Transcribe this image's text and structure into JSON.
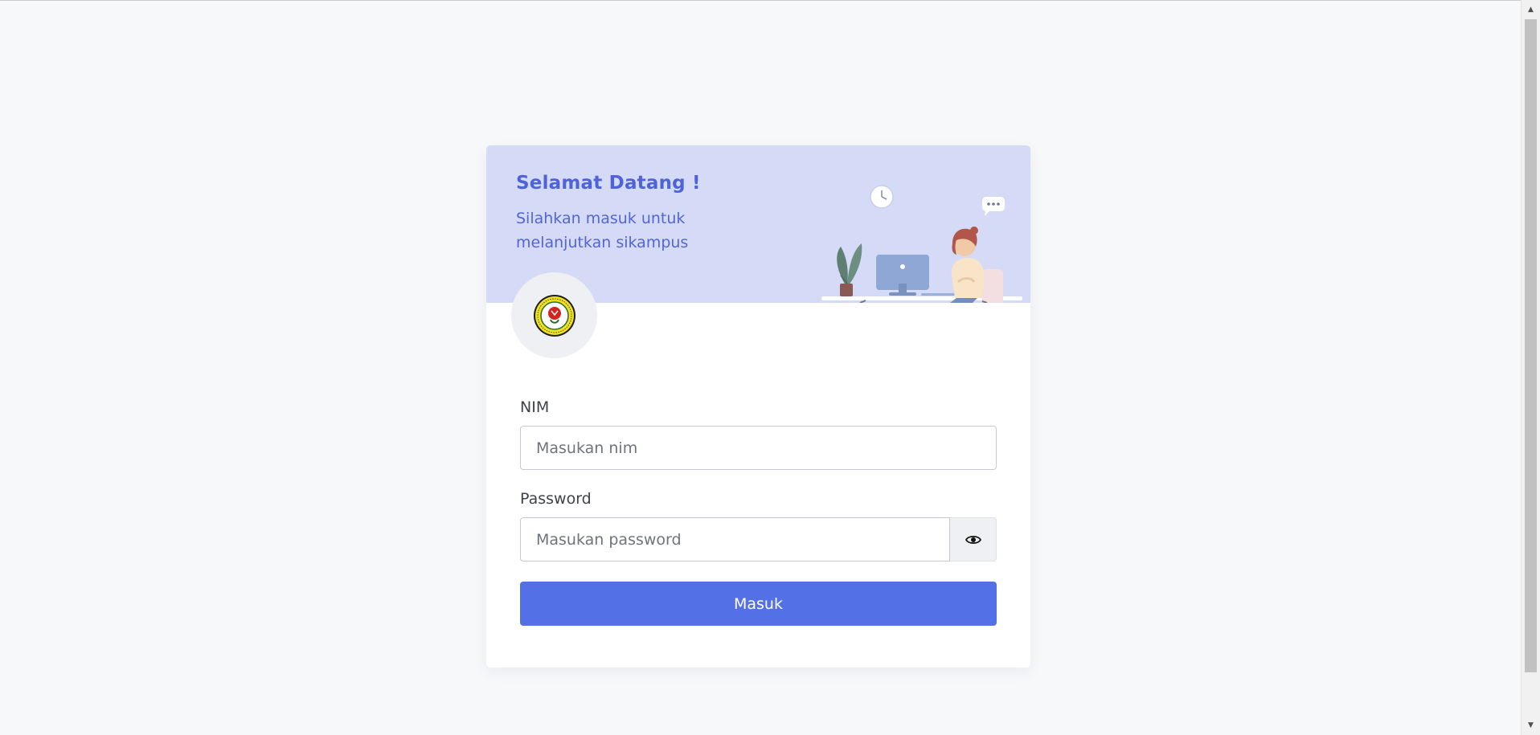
{
  "banner": {
    "title": "Selamat Datang !",
    "subtitle": "Silahkan masuk untuk melanjutkan sikampus",
    "illustration": "woman-at-desk-illustration",
    "logo": "university-seal-logo"
  },
  "form": {
    "nim_label": "NIM",
    "nim_placeholder": "Masukan nim",
    "password_label": "Password",
    "password_placeholder": "Masukan password",
    "toggle_icon": "eye-icon",
    "submit_label": "Masuk"
  },
  "colors": {
    "background": "#f7f8fa",
    "banner": "#d5daf7",
    "accent": "#5470e6",
    "title": "#4e63d8"
  }
}
